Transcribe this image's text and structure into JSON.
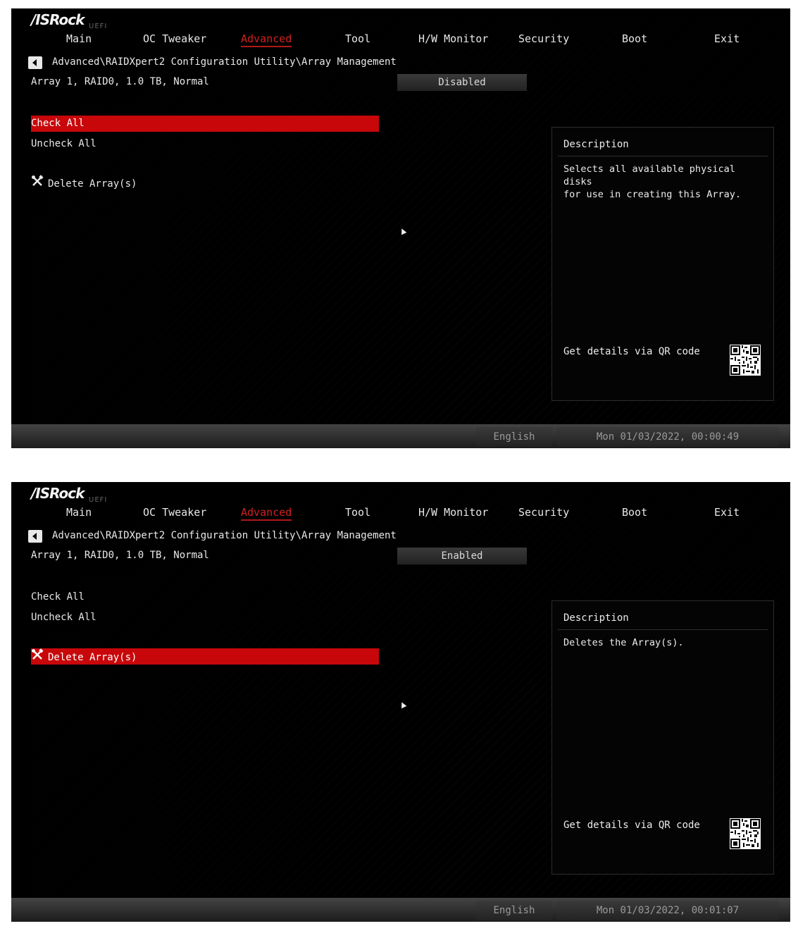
{
  "brand": {
    "logo": "/ISRock",
    "sub": "UEFI"
  },
  "tabs": [
    "Main",
    "OC Tweaker",
    "Advanced",
    "Tool",
    "H/W Monitor",
    "Security",
    "Boot",
    "Exit"
  ],
  "breadcrumb": "Advanced\\RAIDXpert2 Configuration Utility\\Array Management",
  "array_label": "Array 1, RAID0, 1.0 TB, Normal",
  "menu": {
    "check_all": "Check All",
    "uncheck_all": "Uncheck All",
    "delete_array": "Delete Array(s)"
  },
  "description_title": "Description",
  "qr_label": "Get details via QR code",
  "footer": {
    "language": "English"
  },
  "screens": [
    {
      "value": "Disabled",
      "description": "Selects all available physical disks\nfor use in creating this Array.",
      "datetime": "Mon 01/03/2022, 00:00:49"
    },
    {
      "value": "Enabled",
      "description": "Deletes the Array(s).",
      "datetime": "Mon 01/03/2022, 00:01:07"
    }
  ],
  "colors": {
    "accent": "#c8070a",
    "active_tab": "#d42020"
  }
}
